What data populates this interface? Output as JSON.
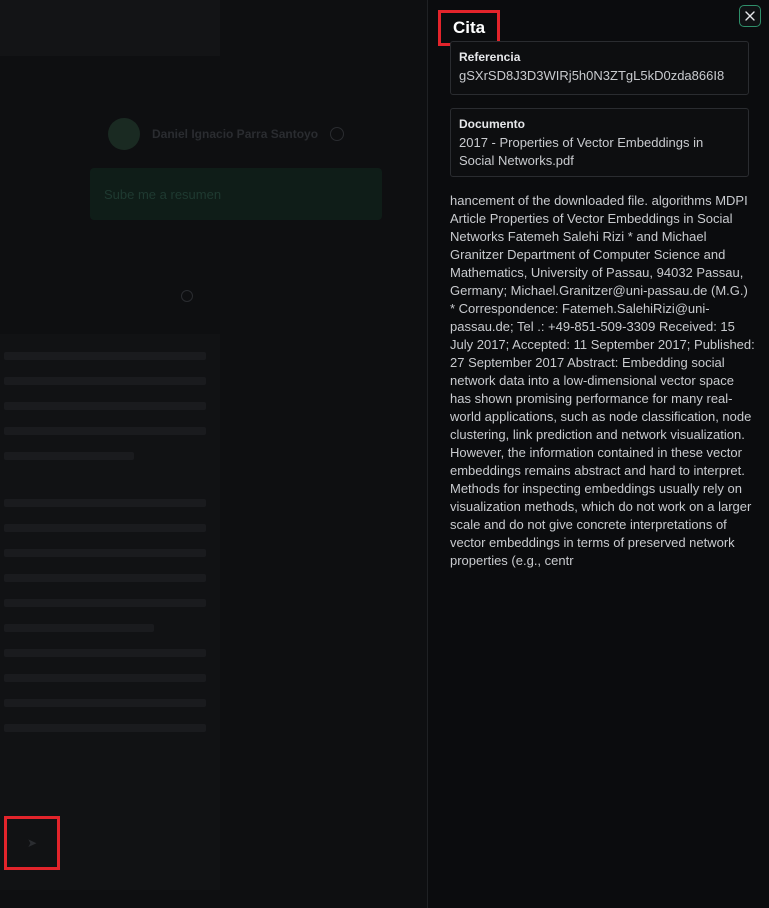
{
  "background": {
    "user_name": "Daniel Ignacio Parra Santoyo",
    "input_hint": "Sube me a resumen",
    "send_icon": "arrow-icon"
  },
  "panel": {
    "title": "Cita",
    "close_icon": "close-icon",
    "reference": {
      "label": "Referencia",
      "value": "gSXrSD8J3D3WIRj5h0N3ZTgL5kD0zda866I8"
    },
    "document": {
      "label": "Documento",
      "value": "2017 - Properties of Vector Embeddings in Social Networks.pdf"
    },
    "citation_text": "hancement of the downloaded file. algorithms MDPI Article Properties of Vector Embeddings in Social Networks Fatemeh Salehi Rizi * and Michael Granitzer Department of Computer Science and Mathematics, University of Passau, 94032 Passau, Germany; Michael.Granitzer@uni-passau.de (M.G.) * Correspondence: Fatemeh.SalehiRizi@uni-passau.de; Tel .: +49-851-509-3309 Received: 15 July 2017; Accepted: 11 September 2017; Published: 27 September 2017 Abstract: Embedding social network data into a low-dimensional vector space has shown promising performance for many real-world applications, such as node classification, node clustering, link prediction and network visualization. However, the information contained in these vector embeddings remains abstract and hard to interpret. Methods for inspecting embeddings usually rely on visualization methods, which do not work on a larger scale and do not give concrete interpretations of vector embeddings in terms of preserved network properties (e.g., centr"
  },
  "colors": {
    "highlight": "#e3242b",
    "accent": "#2f8f6a",
    "panel_bg": "#0b0c0e"
  }
}
